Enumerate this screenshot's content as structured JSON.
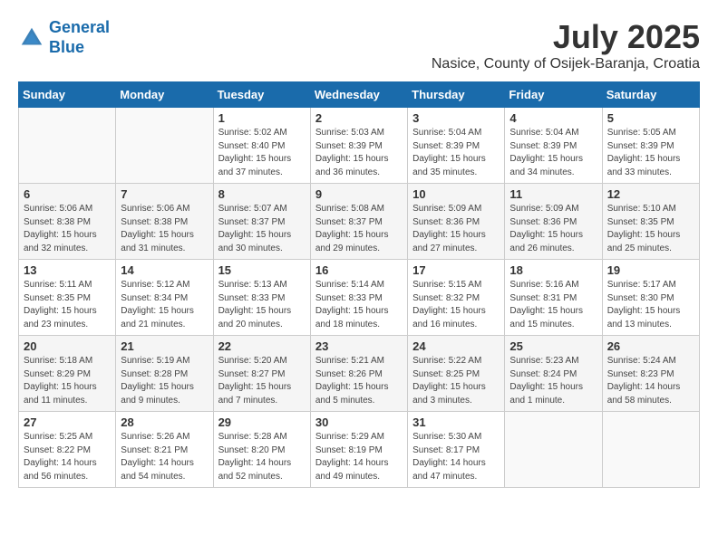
{
  "header": {
    "logo_line1": "General",
    "logo_line2": "Blue",
    "month_year": "July 2025",
    "location": "Nasice, County of Osijek-Baranja, Croatia"
  },
  "weekdays": [
    "Sunday",
    "Monday",
    "Tuesday",
    "Wednesday",
    "Thursday",
    "Friday",
    "Saturday"
  ],
  "weeks": [
    [
      {
        "day": "",
        "empty": true
      },
      {
        "day": "",
        "empty": true
      },
      {
        "day": "1",
        "sunrise": "Sunrise: 5:02 AM",
        "sunset": "Sunset: 8:40 PM",
        "daylight": "Daylight: 15 hours and 37 minutes."
      },
      {
        "day": "2",
        "sunrise": "Sunrise: 5:03 AM",
        "sunset": "Sunset: 8:39 PM",
        "daylight": "Daylight: 15 hours and 36 minutes."
      },
      {
        "day": "3",
        "sunrise": "Sunrise: 5:04 AM",
        "sunset": "Sunset: 8:39 PM",
        "daylight": "Daylight: 15 hours and 35 minutes."
      },
      {
        "day": "4",
        "sunrise": "Sunrise: 5:04 AM",
        "sunset": "Sunset: 8:39 PM",
        "daylight": "Daylight: 15 hours and 34 minutes."
      },
      {
        "day": "5",
        "sunrise": "Sunrise: 5:05 AM",
        "sunset": "Sunset: 8:39 PM",
        "daylight": "Daylight: 15 hours and 33 minutes."
      }
    ],
    [
      {
        "day": "6",
        "sunrise": "Sunrise: 5:06 AM",
        "sunset": "Sunset: 8:38 PM",
        "daylight": "Daylight: 15 hours and 32 minutes."
      },
      {
        "day": "7",
        "sunrise": "Sunrise: 5:06 AM",
        "sunset": "Sunset: 8:38 PM",
        "daylight": "Daylight: 15 hours and 31 minutes."
      },
      {
        "day": "8",
        "sunrise": "Sunrise: 5:07 AM",
        "sunset": "Sunset: 8:37 PM",
        "daylight": "Daylight: 15 hours and 30 minutes."
      },
      {
        "day": "9",
        "sunrise": "Sunrise: 5:08 AM",
        "sunset": "Sunset: 8:37 PM",
        "daylight": "Daylight: 15 hours and 29 minutes."
      },
      {
        "day": "10",
        "sunrise": "Sunrise: 5:09 AM",
        "sunset": "Sunset: 8:36 PM",
        "daylight": "Daylight: 15 hours and 27 minutes."
      },
      {
        "day": "11",
        "sunrise": "Sunrise: 5:09 AM",
        "sunset": "Sunset: 8:36 PM",
        "daylight": "Daylight: 15 hours and 26 minutes."
      },
      {
        "day": "12",
        "sunrise": "Sunrise: 5:10 AM",
        "sunset": "Sunset: 8:35 PM",
        "daylight": "Daylight: 15 hours and 25 minutes."
      }
    ],
    [
      {
        "day": "13",
        "sunrise": "Sunrise: 5:11 AM",
        "sunset": "Sunset: 8:35 PM",
        "daylight": "Daylight: 15 hours and 23 minutes."
      },
      {
        "day": "14",
        "sunrise": "Sunrise: 5:12 AM",
        "sunset": "Sunset: 8:34 PM",
        "daylight": "Daylight: 15 hours and 21 minutes."
      },
      {
        "day": "15",
        "sunrise": "Sunrise: 5:13 AM",
        "sunset": "Sunset: 8:33 PM",
        "daylight": "Daylight: 15 hours and 20 minutes."
      },
      {
        "day": "16",
        "sunrise": "Sunrise: 5:14 AM",
        "sunset": "Sunset: 8:33 PM",
        "daylight": "Daylight: 15 hours and 18 minutes."
      },
      {
        "day": "17",
        "sunrise": "Sunrise: 5:15 AM",
        "sunset": "Sunset: 8:32 PM",
        "daylight": "Daylight: 15 hours and 16 minutes."
      },
      {
        "day": "18",
        "sunrise": "Sunrise: 5:16 AM",
        "sunset": "Sunset: 8:31 PM",
        "daylight": "Daylight: 15 hours and 15 minutes."
      },
      {
        "day": "19",
        "sunrise": "Sunrise: 5:17 AM",
        "sunset": "Sunset: 8:30 PM",
        "daylight": "Daylight: 15 hours and 13 minutes."
      }
    ],
    [
      {
        "day": "20",
        "sunrise": "Sunrise: 5:18 AM",
        "sunset": "Sunset: 8:29 PM",
        "daylight": "Daylight: 15 hours and 11 minutes."
      },
      {
        "day": "21",
        "sunrise": "Sunrise: 5:19 AM",
        "sunset": "Sunset: 8:28 PM",
        "daylight": "Daylight: 15 hours and 9 minutes."
      },
      {
        "day": "22",
        "sunrise": "Sunrise: 5:20 AM",
        "sunset": "Sunset: 8:27 PM",
        "daylight": "Daylight: 15 hours and 7 minutes."
      },
      {
        "day": "23",
        "sunrise": "Sunrise: 5:21 AM",
        "sunset": "Sunset: 8:26 PM",
        "daylight": "Daylight: 15 hours and 5 minutes."
      },
      {
        "day": "24",
        "sunrise": "Sunrise: 5:22 AM",
        "sunset": "Sunset: 8:25 PM",
        "daylight": "Daylight: 15 hours and 3 minutes."
      },
      {
        "day": "25",
        "sunrise": "Sunrise: 5:23 AM",
        "sunset": "Sunset: 8:24 PM",
        "daylight": "Daylight: 15 hours and 1 minute."
      },
      {
        "day": "26",
        "sunrise": "Sunrise: 5:24 AM",
        "sunset": "Sunset: 8:23 PM",
        "daylight": "Daylight: 14 hours and 58 minutes."
      }
    ],
    [
      {
        "day": "27",
        "sunrise": "Sunrise: 5:25 AM",
        "sunset": "Sunset: 8:22 PM",
        "daylight": "Daylight: 14 hours and 56 minutes."
      },
      {
        "day": "28",
        "sunrise": "Sunrise: 5:26 AM",
        "sunset": "Sunset: 8:21 PM",
        "daylight": "Daylight: 14 hours and 54 minutes."
      },
      {
        "day": "29",
        "sunrise": "Sunrise: 5:28 AM",
        "sunset": "Sunset: 8:20 PM",
        "daylight": "Daylight: 14 hours and 52 minutes."
      },
      {
        "day": "30",
        "sunrise": "Sunrise: 5:29 AM",
        "sunset": "Sunset: 8:19 PM",
        "daylight": "Daylight: 14 hours and 49 minutes."
      },
      {
        "day": "31",
        "sunrise": "Sunrise: 5:30 AM",
        "sunset": "Sunset: 8:17 PM",
        "daylight": "Daylight: 14 hours and 47 minutes."
      },
      {
        "day": "",
        "empty": true
      },
      {
        "day": "",
        "empty": true
      }
    ]
  ]
}
